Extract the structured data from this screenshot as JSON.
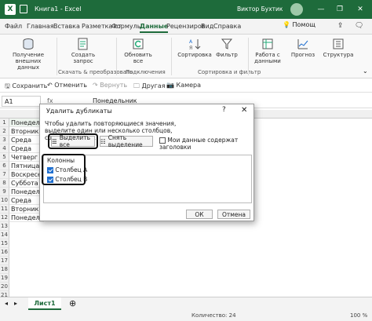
{
  "window": {
    "title": "Книга1 - Excel",
    "user": "Виктор Бухтик",
    "min": "—",
    "restore": "❐",
    "close": "✕"
  },
  "tabs": [
    "Файл",
    "Главная",
    "Вставка",
    "Разметка ст",
    "Формулы",
    "Данные",
    "Рецензиров",
    "Вид",
    "Справка"
  ],
  "search": "Помощ",
  "ribbon": {
    "get_data": "Получение внешних данных",
    "create_query": "Создать запрос",
    "refresh_all": "Обновить все",
    "sort": "Сортировка",
    "filter": "Фильтр",
    "data_tools": "Работа с данными",
    "forecast": "Прогноз",
    "structure": "Структура",
    "group1": "Скачать & преобразовать",
    "group2": "Подключения",
    "group3": "Сортировка и фильтр"
  },
  "qat": {
    "save": "Сохранить",
    "undo": "Отменить",
    "redo": "Вернуть",
    "other": "Другая",
    "camera": "Камера"
  },
  "namebox": "A1",
  "formula": "Понедельник",
  "rows": [
    "1",
    "2",
    "3",
    "4",
    "5",
    "6",
    "7",
    "8",
    "9",
    "10",
    "11",
    "12",
    "13",
    "14",
    "15",
    "16",
    "17",
    "18",
    "19",
    "20",
    "21"
  ],
  "cells": [
    "Понедель",
    "Вторник",
    "Среда",
    "Среда",
    "Четверг",
    "Пятница",
    "Воскресен",
    "Суббота",
    "Понедель",
    "Среда",
    "Вторник",
    "Понедель"
  ],
  "sheet": "Лист1",
  "status": {
    "count": "Количество: 24",
    "zoom": "100 %"
  },
  "dialog": {
    "title": "Удалить дубликаты",
    "help": "?",
    "close": "✕",
    "description": "Чтобы удалить повторяющиеся значения, выделите один или несколько столбцов, содержащих их.",
    "select_all": "Выделить все",
    "unselect_all": "Снять выделение",
    "has_headers": "Мои данные содержат заголовки",
    "columns_header": "Колонны",
    "col_a": "Столбец A",
    "col_b": "Столбец B",
    "ok": "ОК",
    "cancel": "Отмена"
  },
  "colors": {
    "accent": "#1e6b3b",
    "checkbox": "#1f6fd0"
  }
}
